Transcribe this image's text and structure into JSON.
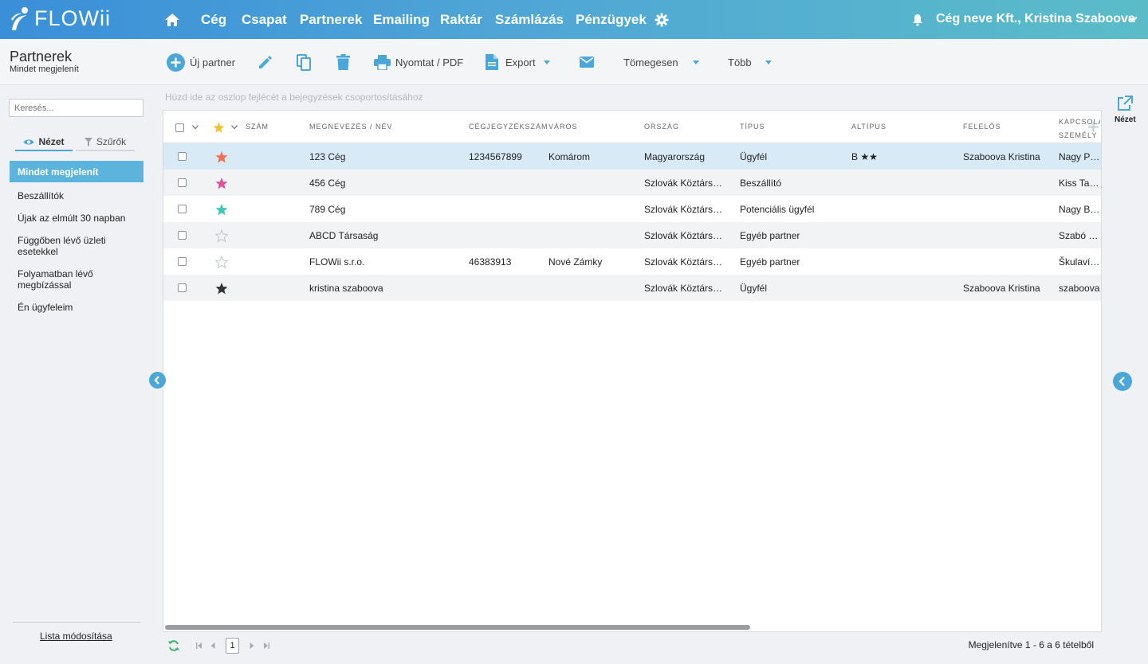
{
  "app": {
    "logo_text": "FLOWii"
  },
  "nav": {
    "items": [
      "Cég",
      "Csapat",
      "Partnerek",
      "Emailing",
      "Raktár",
      "Számlázás",
      "Pénzügyek"
    ],
    "user": "Cég neve Kft., Kristina Szaboova"
  },
  "page": {
    "title": "Partnerek",
    "subtitle": "Mindet megjelenít"
  },
  "toolbar": {
    "new_partner": "Új partner",
    "print": "Nyomtat / PDF",
    "export": "Export",
    "bulk": "Tömegesen",
    "more": "Több"
  },
  "sidebar": {
    "search_placeholder": "Keresés...",
    "tab_view": "Nézet",
    "tab_filters": "Szűrők",
    "active_item": "Mindet megjelenít",
    "items": [
      "Beszállítók",
      "Újak az elmúlt 30 napban",
      "Függőben lévő üzleti esetekkel",
      "Folyamatban lévő megbízással",
      "Én ügyfeleim"
    ],
    "footer_link": "Lista módosítása"
  },
  "grid": {
    "group_hint": "Húzd ide az oszlop fejlécét a bejegyzések csoportosításához",
    "columns": [
      "SZÁM",
      "MEGNEVEZÉS / NÉV",
      "CÉGJEGYZÉKSZÁM",
      "VÁROS",
      "ORSZÁG",
      "TÍPUS",
      "ALTÍPUS",
      "FELELŐS",
      "KAPCSOLAT SZEMÉLY"
    ],
    "rows": [
      {
        "star": "#f07050",
        "name": "123 Cég",
        "reg": "1234567899",
        "city": "Komárom",
        "country": "Magyarország",
        "type": "Ügyfél",
        "subtype": "B ★★",
        "owner": "Szaboova Kristina",
        "contact": "Nagy Péter"
      },
      {
        "star": "#e0559a",
        "name": "456 Cég",
        "reg": "",
        "city": "",
        "country": "Szlovák Köztársaság",
        "type": "Beszállító",
        "subtype": "",
        "owner": "",
        "contact": "Kiss Tamás"
      },
      {
        "star": "#40c8b8",
        "name": "789 Cég",
        "reg": "",
        "city": "",
        "country": "Szlovák Köztársaság",
        "type": "Potenciális ügyfél",
        "subtype": "",
        "owner": "",
        "contact": "Nagy Balázs"
      },
      {
        "star": "none",
        "name": "ABCD Társaság",
        "reg": "",
        "city": "",
        "country": "Szlovák Köztársaság",
        "type": "Egyéb partner",
        "subtype": "",
        "owner": "",
        "contact": "Szabó Levente"
      },
      {
        "star": "none",
        "name": "FLOWii s.r.o.",
        "reg": "46383913",
        "city": "Nové Zámky",
        "country": "Szlovák Köztársaság",
        "type": "Egyéb partner",
        "subtype": "",
        "owner": "",
        "contact": "Škulavík Peter"
      },
      {
        "star": "#333333",
        "name": "kristina szaboova",
        "reg": "",
        "city": "",
        "country": "Szlovák Köztársaság",
        "type": "Ügyfél",
        "subtype": "",
        "owner": "Szaboova Kristina",
        "contact": "szaboova"
      }
    ]
  },
  "right_panel": {
    "view_label": "Nézet"
  },
  "pager": {
    "current_page": "1",
    "info": "Megjelenítve 1 - 6 a 6 tételből"
  },
  "colors": {
    "accent": "#4aa7d8",
    "selected_row": "#d9eaf7",
    "header_start": "#3a8fd8",
    "header_end": "#5bbcc8"
  }
}
